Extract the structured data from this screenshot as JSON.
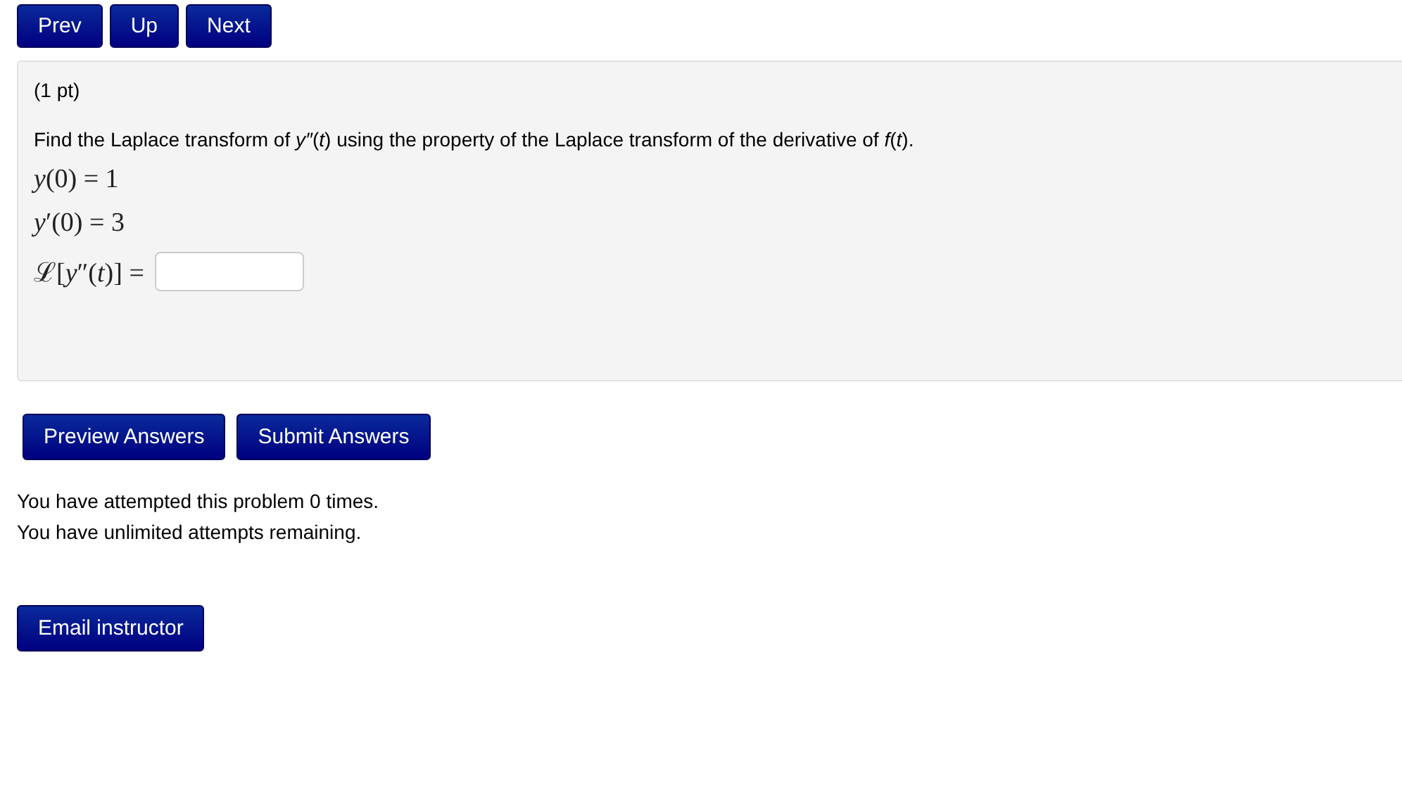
{
  "nav_buttons": [
    "Prev",
    "Up",
    "Next"
  ],
  "problem": {
    "points": "(1 pt)",
    "prompt": "Find the Laplace transform of *y″*(*t*) using the property of the Laplace transform of the derivative of *f*(*t*).",
    "conditions": [
      "*y*(0) = 1",
      "*y*′(0) = 3"
    ],
    "answer": {
      "label": "ℒ[*y*″(*t*)] ="
    }
  },
  "action_buttons": [
    "Preview Answers",
    "Submit Answers"
  ],
  "messages": [
    "You have attempted this problem 0 times.",
    "You have unlimited attempts remaining."
  ],
  "email_button": "Email instructor"
}
